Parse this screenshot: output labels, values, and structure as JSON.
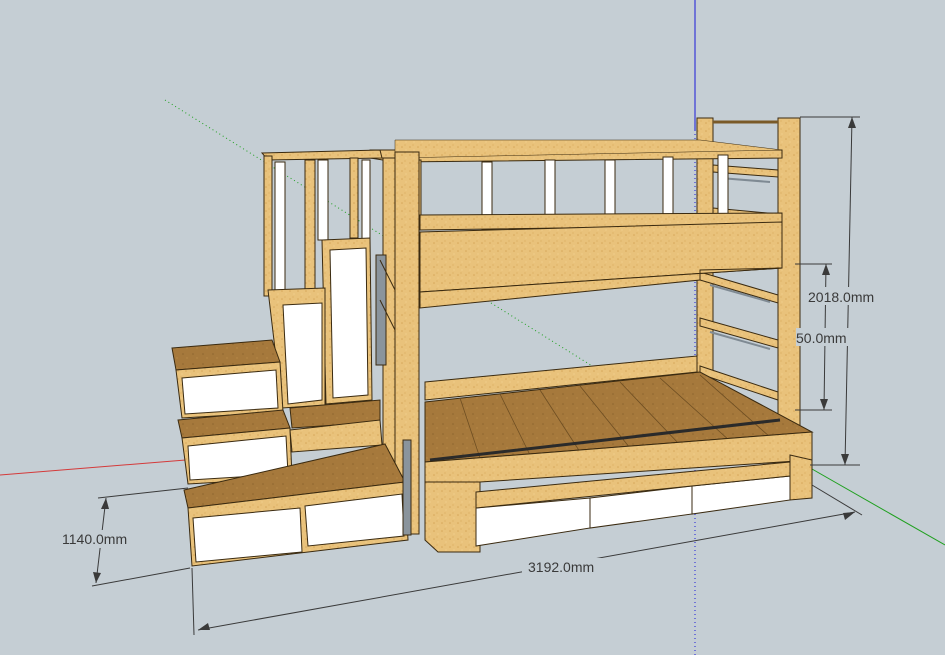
{
  "dimensions": {
    "height_total": "2018.0mm",
    "height_lower": "50.0mm",
    "stair_height": "1140.0mm",
    "total_length": "3192.0mm"
  },
  "colors": {
    "background": "#c5ced4",
    "wood": "#e9c27b",
    "wood_dark": "#b8863c",
    "wood_top": "#a6793c",
    "panel_white": "#ffffff",
    "outline": "#3a2a10",
    "axis_red": "#d43a3a",
    "axis_green": "#1fa01f",
    "axis_blue": "#1a1ad8"
  },
  "icons": [
    "axis-origin"
  ]
}
